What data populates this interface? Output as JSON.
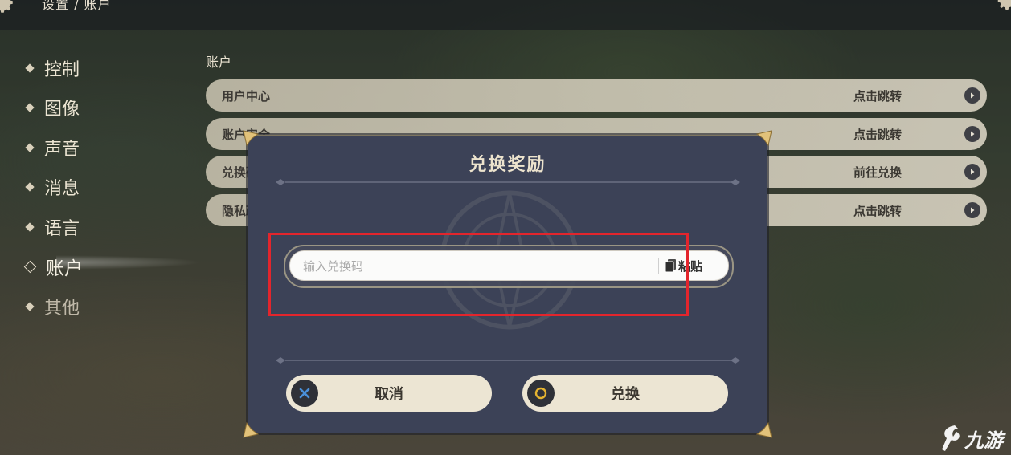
{
  "header": {
    "breadcrumb": "设置 / 账户"
  },
  "sidebar": {
    "items": [
      {
        "label": "控制",
        "active": false
      },
      {
        "label": "图像",
        "active": false
      },
      {
        "label": "声音",
        "active": false
      },
      {
        "label": "消息",
        "active": false
      },
      {
        "label": "语言",
        "active": false
      },
      {
        "label": "账户",
        "active": true
      },
      {
        "label": "其他",
        "active": false
      }
    ]
  },
  "account": {
    "title": "账户",
    "rows": [
      {
        "label": "用户中心",
        "action": "点击跳转"
      },
      {
        "label": "账户安全",
        "action": "点击跳转"
      },
      {
        "label": "兑换码",
        "action": "前往兑换"
      },
      {
        "label": "隐私政策",
        "action": "点击跳转"
      }
    ]
  },
  "dialog": {
    "title": "兑换奖励",
    "input_placeholder": "输入兑换码",
    "input_value": "",
    "paste_label": "粘贴",
    "cancel_label": "取消",
    "confirm_label": "兑换"
  },
  "watermark": {
    "text": "九游"
  },
  "colors": {
    "highlight": "#e3252c",
    "dialog_bg": "#3c4257",
    "button_bg": "#ece5d3",
    "accent_ring": "#e6b430",
    "cancel_x": "#4a90d9"
  }
}
